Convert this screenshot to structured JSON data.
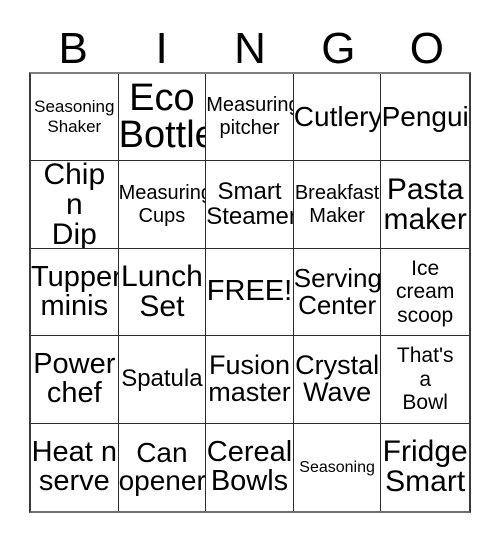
{
  "card": {
    "title": "Bingo Card",
    "header_letters": [
      "B",
      "I",
      "N",
      "G",
      "O"
    ],
    "columns": 5,
    "rows": 5,
    "free_space_label": "FREE!",
    "colors": {
      "background": "#ffffff",
      "text": "#000000",
      "grid_line": "#2b2b2b",
      "outer_border": "#6e6e6e"
    },
    "cells": [
      {
        "text": "Seasoning\nShaker",
        "size": "fs-17",
        "free": false
      },
      {
        "text": "Eco\nBottle",
        "size": "fs-38",
        "free": false
      },
      {
        "text": "Measuring\npitcher",
        "size": "fs-20",
        "free": false
      },
      {
        "text": "Cutlery",
        "size": "fs-28",
        "free": false
      },
      {
        "text": "Pengui",
        "size": "fs-28",
        "free": false,
        "clipped": true
      },
      {
        "text": "Chip n\nDip",
        "size": "fs-30",
        "free": false
      },
      {
        "text": "Measuring\nCups",
        "size": "fs-20",
        "free": false
      },
      {
        "text": "Smart\nSteamer",
        "size": "fs-24",
        "free": false
      },
      {
        "text": "Breakfast\nMaker",
        "size": "fs-20",
        "free": false
      },
      {
        "text": "Pasta\nmaker",
        "size": "fs-30",
        "free": false
      },
      {
        "text": "Tupper\nminis",
        "size": "fs-29",
        "free": false
      },
      {
        "text": "Lunch\nSet",
        "size": "fs-30",
        "free": false
      },
      {
        "text": "FREE!",
        "size": "fs-29",
        "free": true
      },
      {
        "text": "Serving\nCenter",
        "size": "fs-26",
        "free": false
      },
      {
        "text": "Ice\ncream\nscoop",
        "size": "fs-21",
        "free": false
      },
      {
        "text": "Power\nchef",
        "size": "fs-29",
        "free": false
      },
      {
        "text": "Spatula",
        "size": "fs-24",
        "free": false
      },
      {
        "text": "Fusion\nmaster",
        "size": "fs-27",
        "free": false
      },
      {
        "text": "Crystal\nWave",
        "size": "fs-27",
        "free": false
      },
      {
        "text": "That's\na\nBowl",
        "size": "fs-21",
        "free": false
      },
      {
        "text": "Heat n\nserve",
        "size": "fs-29",
        "free": false
      },
      {
        "text": "Can\nopener",
        "size": "fs-28",
        "free": false
      },
      {
        "text": "Cereal\nBowls",
        "size": "fs-29",
        "free": false
      },
      {
        "text": "Seasoning",
        "size": "fs-16",
        "free": false
      },
      {
        "text": "Fridge\nSmart",
        "size": "fs-30",
        "free": false
      }
    ]
  }
}
